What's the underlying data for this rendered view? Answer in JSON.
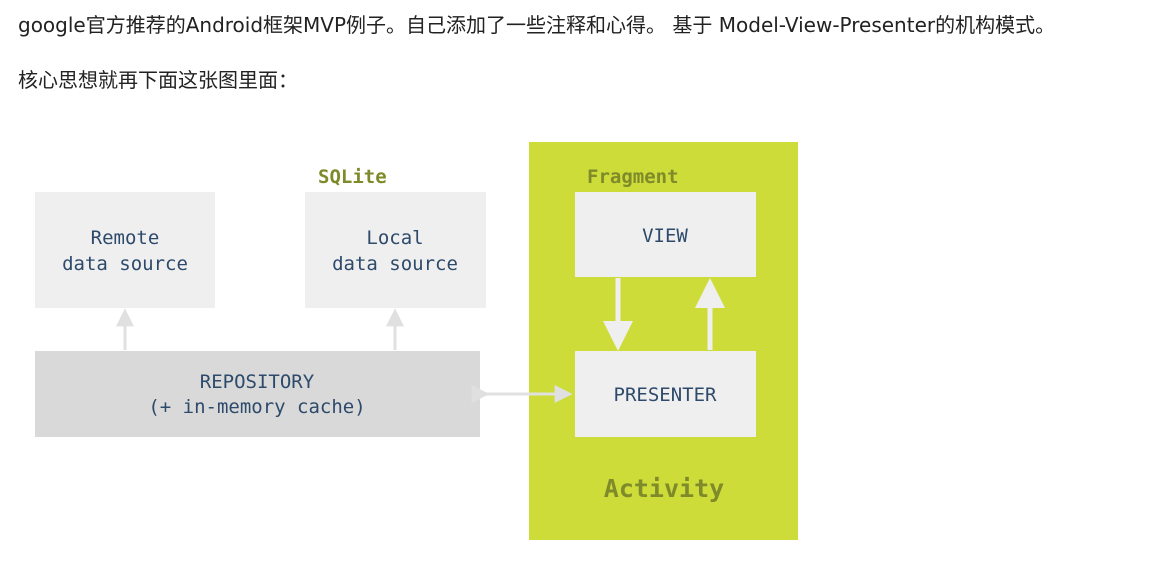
{
  "intro": {
    "line1": "google官方推荐的Android框架MVP例子。自己添加了一些注释和心得。 基于 Model-View-Presenter的机构模式。",
    "line2": "核心思想就再下面这张图里面："
  },
  "diagram": {
    "remote": {
      "line1": "Remote",
      "line2": "data source"
    },
    "local": {
      "line1": "Local",
      "line2": "data source",
      "tag": "SQLite"
    },
    "repository": {
      "line1": "REPOSITORY",
      "line2": "(+ in-memory cache)"
    },
    "activity": {
      "label": "Activity",
      "fragment_label": "Fragment"
    },
    "view": {
      "label": "VIEW"
    },
    "presenter": {
      "label": "PRESENTER"
    }
  },
  "colors": {
    "light_box": "#efefef",
    "repository_box": "#d9d9d9",
    "activity": "#cddc39",
    "arrow": "#e5e5e5",
    "text_blue": "#2d4a6b",
    "olive": "#7f8a2a"
  }
}
